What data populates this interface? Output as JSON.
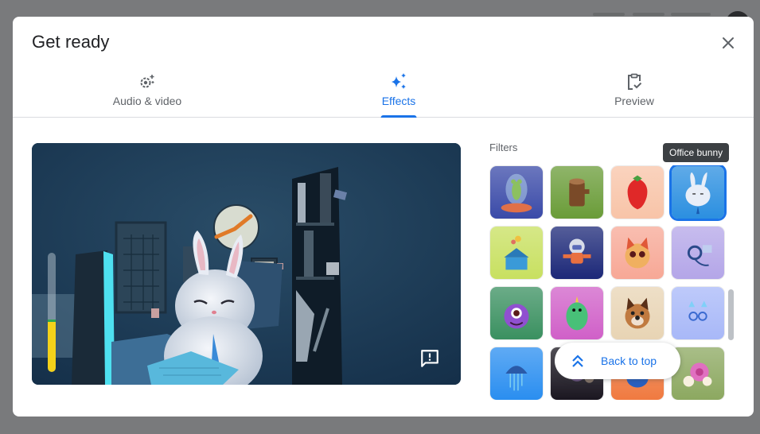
{
  "dialog": {
    "title": "Get ready",
    "close_icon": "close-icon"
  },
  "tabs": [
    {
      "label": "Audio & video",
      "icon": "gear-sparkle-icon",
      "active": false
    },
    {
      "label": "Effects",
      "icon": "sparkle-icon",
      "active": true
    },
    {
      "label": "Preview",
      "icon": "clipboard-check-icon",
      "active": false
    }
  ],
  "video": {
    "feedback_icon": "feedback-icon",
    "audio_level": 0.42
  },
  "filters": {
    "heading": "Filters",
    "tooltip": "Office bunny",
    "selected": "Office bunny",
    "items": [
      {
        "name": "Alien in dome",
        "bg": "#3a4aa8"
      },
      {
        "name": "Tree stump",
        "bg": "#6a9c38"
      },
      {
        "name": "Strawberry",
        "bg": "#f8c4a8"
      },
      {
        "name": "Office bunny",
        "bg": "#2b8fe0"
      },
      {
        "name": "Circus tent",
        "bg": "#c8e060"
      },
      {
        "name": "Astronaut",
        "bg": "#1c2878"
      },
      {
        "name": "Cat",
        "bg": "#f7a896"
      },
      {
        "name": "Headset",
        "bg": "#b4a6e8"
      },
      {
        "name": "Monster",
        "bg": "#3a9060"
      },
      {
        "name": "Dinosaur",
        "bg": "#d060c8"
      },
      {
        "name": "Dog",
        "bg": "#e8d4b4"
      },
      {
        "name": "Cat glasses",
        "bg": "#a8b8f8"
      },
      {
        "name": "Jellyfish",
        "bg": "#2a8ef0"
      },
      {
        "name": "Night bug",
        "bg": "#1a1620"
      },
      {
        "name": "Orange creature",
        "bg": "#f07a40"
      },
      {
        "name": "Flowers",
        "bg": "#8ca860"
      }
    ]
  },
  "back_to_top": {
    "label": "Back to top",
    "icon": "double-chevron-up-icon"
  },
  "colors": {
    "accent": "#1a73e8",
    "text_secondary": "#5f6368"
  }
}
